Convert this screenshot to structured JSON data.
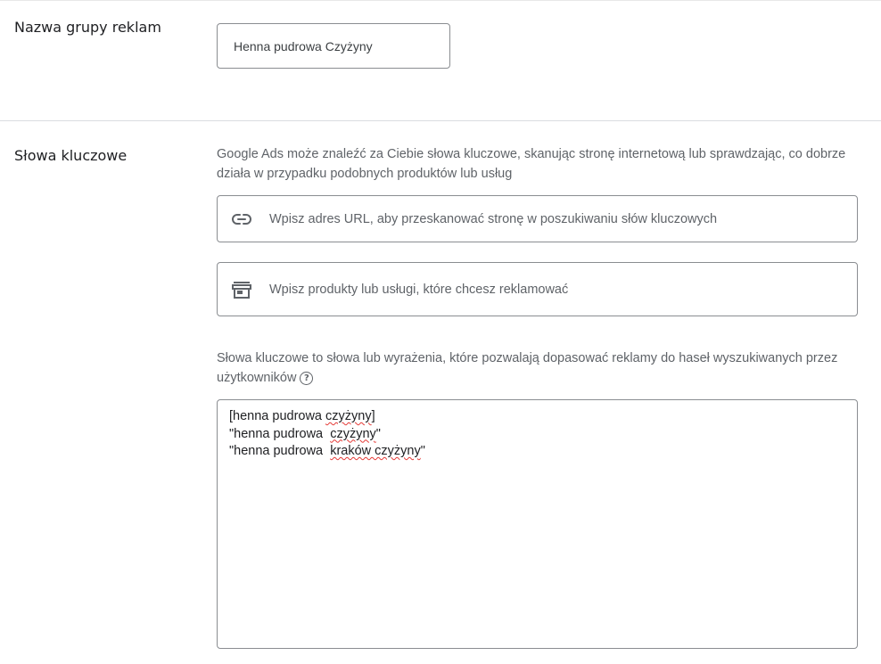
{
  "ad_group": {
    "title": "Nazwa grupy reklam",
    "name_value": "Henna pudrowa Czyżyny"
  },
  "keywords": {
    "title": "Słowa kluczowe",
    "description": "Google Ads może znaleźć za Ciebie słowa kluczowe, skanując stronę internetową lub sprawdzając, co dobrze działa w przypadku podobnych produktów lub usług",
    "url_placeholder": "Wpisz adres URL, aby przeskanować stronę w poszukiwaniu słów kluczowych",
    "url_icon": "link-icon",
    "products_placeholder": "Wpisz produkty lub usługi, które chcesz reklamować",
    "products_icon": "store-icon",
    "info_text": "Słowa kluczowe to słowa lub wyrażenia, które pozwalają dopasować reklamy do haseł wyszukiwanych przez użytkowników",
    "help_icon": "help-icon",
    "entries": [
      {
        "prefix": "[henna pudrowa ",
        "flagged": "czyżyny",
        "suffix": "]"
      },
      {
        "prefix": "\"henna pudrowa  ",
        "flagged": "czyżyny",
        "suffix": "\""
      },
      {
        "prefix": "\"henna pudrowa  ",
        "flagged": "kraków czyżyny",
        "suffix": "\""
      }
    ]
  },
  "colors": {
    "border": "#8a8d91",
    "divider": "#dadce0",
    "spellcheck": "#e53935"
  }
}
